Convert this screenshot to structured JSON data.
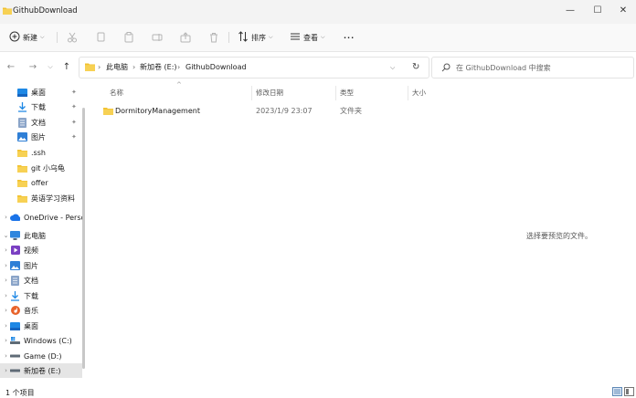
{
  "window": {
    "title": "GithubDownload",
    "minimize": "—",
    "maximize": "☐",
    "close": "✕"
  },
  "toolbar": {
    "new_label": "新建",
    "sort_label": "排序",
    "view_label": "查看",
    "more_label": "···"
  },
  "navigation": {
    "breadcrumbs": [
      "此电脑",
      "新加卷 (E:)",
      "GithubDownload"
    ],
    "search_placeholder": "在 GithubDownload 中搜索"
  },
  "sidebar": {
    "quick_access": [
      {
        "label": "桌面",
        "icon": "desktop-icon",
        "pinned": true
      },
      {
        "label": "下载",
        "icon": "download-icon",
        "pinned": true
      },
      {
        "label": "文档",
        "icon": "document-icon",
        "pinned": true
      },
      {
        "label": "图片",
        "icon": "picture-icon",
        "pinned": true
      },
      {
        "label": ".ssh",
        "icon": "folder-icon",
        "pinned": false
      },
      {
        "label": "git 小乌龟",
        "icon": "folder-icon",
        "pinned": false
      },
      {
        "label": "offer",
        "icon": "folder-icon",
        "pinned": false
      },
      {
        "label": "英语学习资料",
        "icon": "folder-icon",
        "pinned": false
      }
    ],
    "onedrive": {
      "label": "OneDrive - Perso",
      "icon": "cloud-icon"
    },
    "this_pc": {
      "label": "此电脑",
      "icon": "computer-icon"
    },
    "this_pc_children": [
      {
        "label": "视频",
        "icon": "video-icon"
      },
      {
        "label": "图片",
        "icon": "picture-icon"
      },
      {
        "label": "文档",
        "icon": "document-icon"
      },
      {
        "label": "下载",
        "icon": "download-icon"
      },
      {
        "label": "音乐",
        "icon": "music-icon"
      },
      {
        "label": "桌面",
        "icon": "desktop-icon"
      },
      {
        "label": "Windows (C:)",
        "icon": "drive-icon"
      },
      {
        "label": "Game (D:)",
        "icon": "drive-icon"
      },
      {
        "label": "新加卷 (E:)",
        "icon": "drive-icon",
        "selected": true
      }
    ]
  },
  "columns": {
    "name": "名称",
    "modified": "修改日期",
    "type": "类型",
    "size": "大小"
  },
  "files": [
    {
      "name": "DormitoryManagement",
      "modified": "2023/1/9 23:07",
      "type": "文件夹",
      "size": ""
    }
  ],
  "preview": {
    "message": "选择要预览的文件。"
  },
  "status": {
    "item_count": "1 个项目"
  },
  "colors": {
    "folder": "#f2c12e",
    "accent": "#0067c0",
    "selected_bg": "#e5e5e5"
  }
}
